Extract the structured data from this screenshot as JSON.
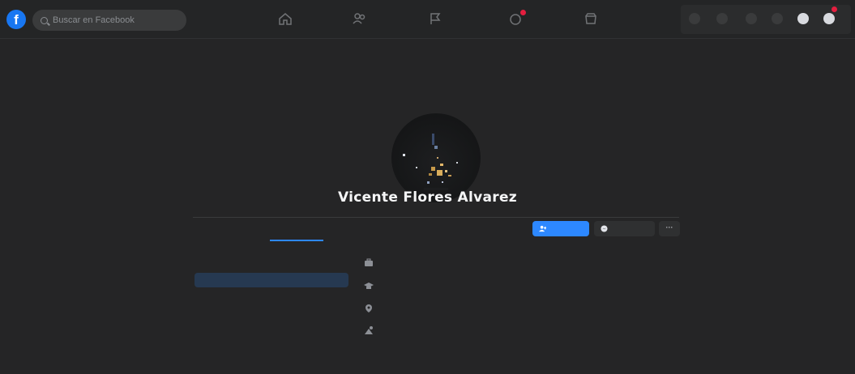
{
  "header": {
    "logo": "f",
    "search_placeholder": "Buscar en Facebook"
  },
  "profile": {
    "name": "Vicente Flores Alvarez"
  },
  "actions": {
    "more_label": "···"
  },
  "icons": {
    "logo": "facebook-icon",
    "search": "search-icon",
    "nav": [
      "home-icon",
      "friends-icon",
      "flag-icon",
      "notifications-icon",
      "marketplace-icon"
    ],
    "add_friend": "add-friend-icon",
    "message": "messenger-icon"
  },
  "colors": {
    "accent": "#2d88ff",
    "background": "#252526",
    "topbar": "#242526",
    "button": "#3a3b3c",
    "badge": "#e41e3f",
    "active_side": "#263951"
  }
}
